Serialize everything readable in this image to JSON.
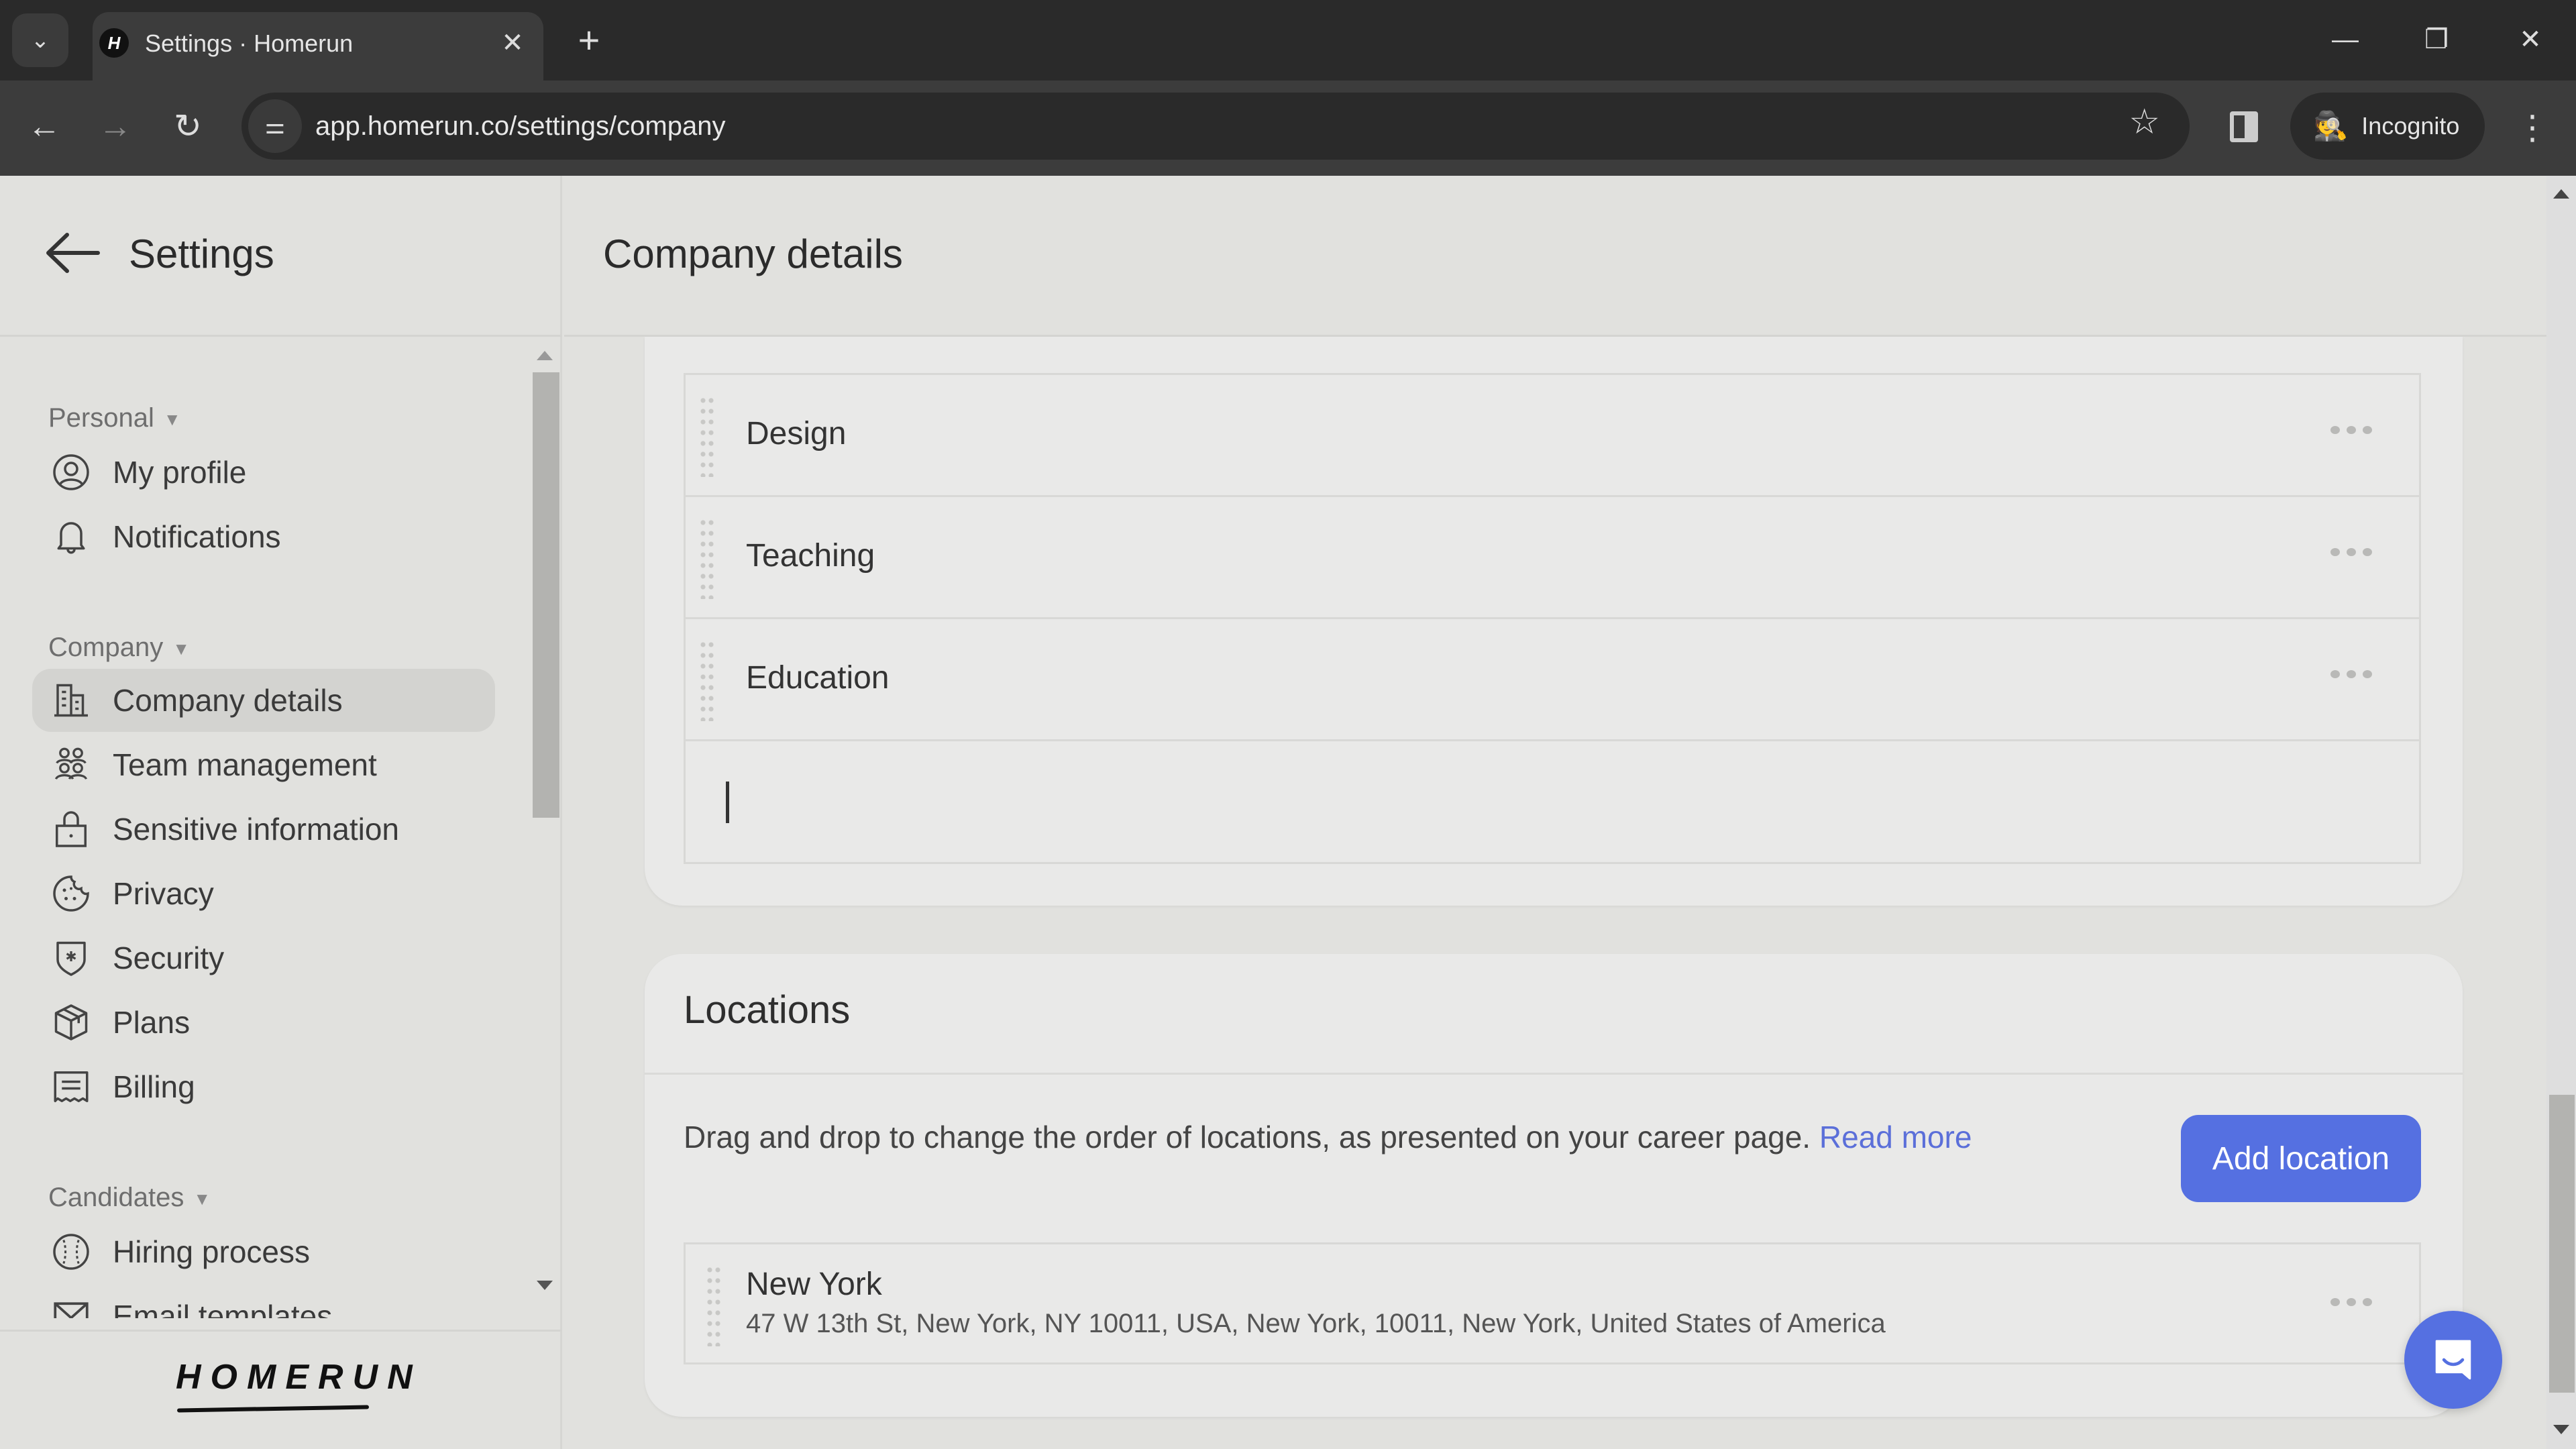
{
  "browser": {
    "tab_title": "Settings · Homerun",
    "favicon_letter": "H",
    "url": "app.homerun.co/settings/company",
    "incognito_label": "Incognito",
    "icons": {
      "tab_list": "chevron-down-icon",
      "close_tab": "close-icon",
      "new_tab": "plus-icon",
      "back": "arrow-left-icon",
      "forward": "arrow-right-icon",
      "reload": "reload-icon",
      "site_info": "tune-icon",
      "bookmark": "star-icon",
      "side_panel": "side-panel-icon",
      "incognito": "incognito-icon",
      "menu": "kebab-icon",
      "minimize": "minimize-icon",
      "restore": "restore-icon",
      "close_window": "close-icon"
    }
  },
  "sidebar": {
    "title": "Settings",
    "groups": [
      {
        "label": "Personal",
        "items": [
          {
            "label": "My profile",
            "icon": "user-circle-icon"
          },
          {
            "label": "Notifications",
            "icon": "bell-icon"
          }
        ]
      },
      {
        "label": "Company",
        "items": [
          {
            "label": "Company details",
            "icon": "building-icon",
            "active": true
          },
          {
            "label": "Team management",
            "icon": "team-icon"
          },
          {
            "label": "Sensitive information",
            "icon": "lock-icon"
          },
          {
            "label": "Privacy",
            "icon": "cookie-icon"
          },
          {
            "label": "Security",
            "icon": "shield-icon"
          },
          {
            "label": "Plans",
            "icon": "box-icon"
          },
          {
            "label": "Billing",
            "icon": "receipt-icon"
          }
        ]
      },
      {
        "label": "Candidates",
        "items": [
          {
            "label": "Hiring process",
            "icon": "baseball-icon"
          },
          {
            "label": "Email templates",
            "icon": "mail-icon"
          }
        ]
      }
    ],
    "logo": "HOMERUN"
  },
  "main": {
    "title": "Company details",
    "departments": {
      "items": [
        "Design",
        "Teaching",
        "Education"
      ],
      "new_item_value": ""
    },
    "locations": {
      "title": "Locations",
      "description": "Drag and drop to change the order of locations, as presented on your career page.",
      "read_more": "Read more",
      "add_button": "Add location",
      "items": [
        {
          "name": "New York",
          "address": "47 W 13th St, New York, NY 10011, USA, New York, 10011, New York, United States of America"
        }
      ]
    }
  },
  "colors": {
    "accent": "#5570e1",
    "link": "#5b6fd9",
    "background": "#e1e1de",
    "card": "#e9e9e8"
  }
}
